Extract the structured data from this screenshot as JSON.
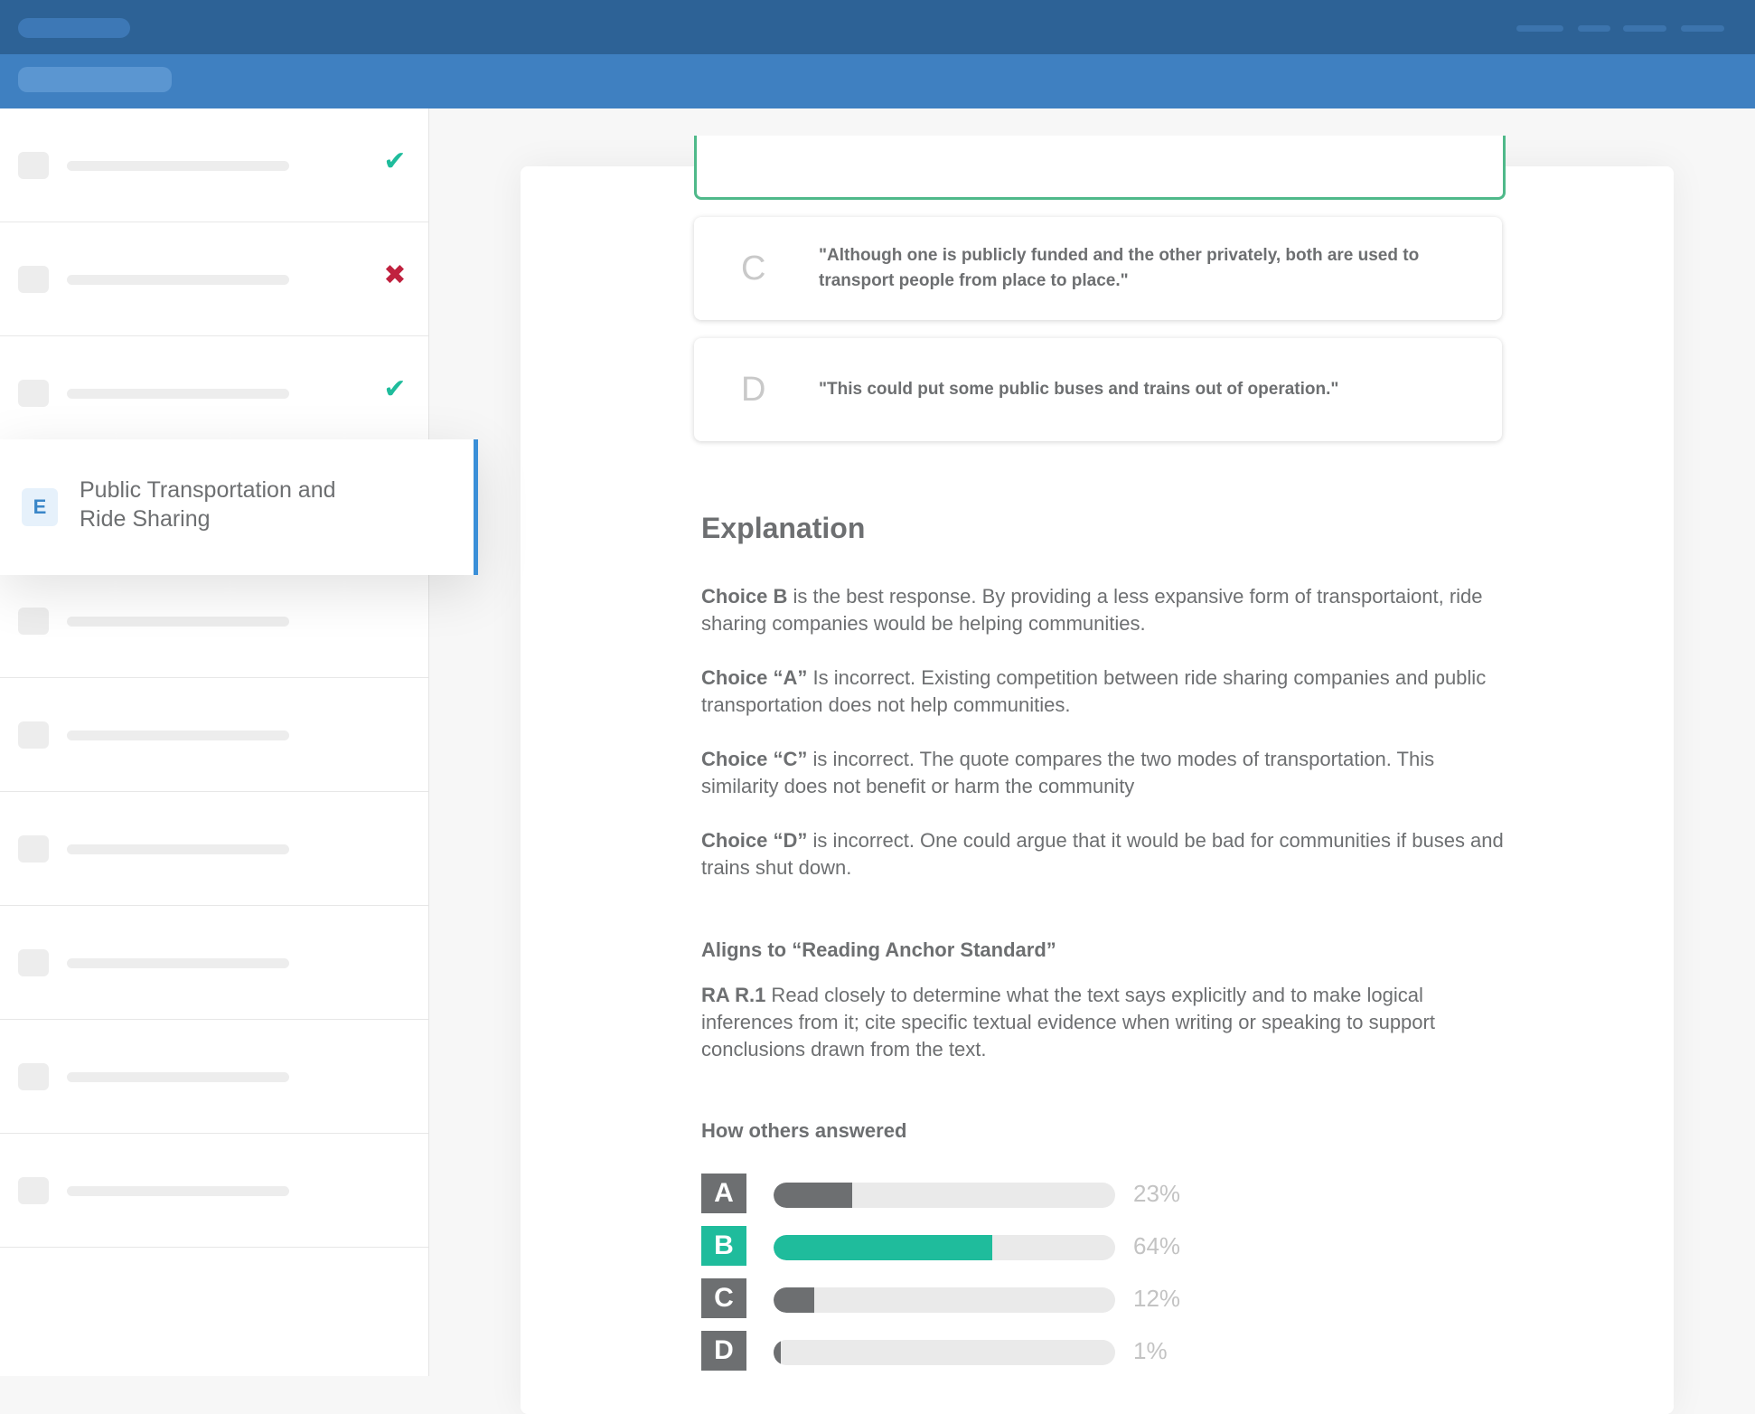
{
  "header": {},
  "sidebar": {
    "rows": [
      {
        "status": "correct"
      },
      {
        "status": "incorrect"
      },
      {
        "status": "correct"
      },
      {
        "status": "none"
      },
      {
        "status": "none"
      },
      {
        "status": "none"
      },
      {
        "status": "none"
      },
      {
        "status": "none"
      },
      {
        "status": "none"
      },
      {
        "status": "none"
      }
    ],
    "active": {
      "letter": "E",
      "title": "Public Transportation and Ride Sharing"
    }
  },
  "choices": [
    {
      "letter": "C",
      "text": "\"Although one is publicly funded and the other privately, both are used to transport people from place to place.\""
    },
    {
      "letter": "D",
      "text": "\"This could put some public buses and trains out of operation.\""
    }
  ],
  "explanation": {
    "heading": "Explanation",
    "items": [
      {
        "lead": "Choice B",
        "text": " is the best response. By providing a less expansive form of transportaiont, ride sharing companies would be helping communities."
      },
      {
        "lead": "Choice “A”",
        "text": " Is incorrect. Existing competition between ride sharing companies and public transportation does not help communities."
      },
      {
        "lead": "Choice “C”",
        "text": " is incorrect. The quote compares the two modes of transportation. This similarity does not benefit or harm the community"
      },
      {
        "lead": "Choice “D”",
        "text": " is incorrect. One could argue that it would be bad for communities if buses and trains shut down."
      }
    ]
  },
  "standard": {
    "heading": "Aligns to “Reading Anchor Standard”",
    "code": "RA R.1",
    "text": " Read closely to determine what the text says explicitly and to make logical inferences from it; cite specific textual evidence when writing or speaking to support conclusions drawn from the text."
  },
  "others": {
    "heading": "How others answered",
    "stats": [
      {
        "letter": "A",
        "percent": 23,
        "label": "23%",
        "color": "#6d6f71"
      },
      {
        "letter": "B",
        "percent": 64,
        "label": "64%",
        "color": "#1fbc9c"
      },
      {
        "letter": "C",
        "percent": 12,
        "label": "12%",
        "color": "#6d6f71"
      },
      {
        "letter": "D",
        "percent": 1,
        "label": "1%",
        "color": "#6d6f71"
      }
    ]
  }
}
